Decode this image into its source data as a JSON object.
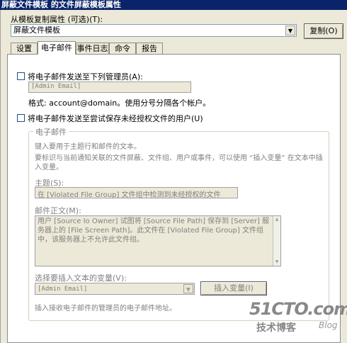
{
  "window": {
    "title": "屏蔽文件模板 的文件屏蔽模板属性"
  },
  "template_copy": {
    "label": "从模板复制属性 (可选)(T):",
    "selected": "屏蔽文件模板",
    "copy_button": "复制(O)"
  },
  "tabs": [
    {
      "label": "设置"
    },
    {
      "label": "电子邮件"
    },
    {
      "label": "事件日志"
    },
    {
      "label": "命令"
    },
    {
      "label": "报告"
    }
  ],
  "active_tab": "电子邮件",
  "email": {
    "admin_checkbox_label": "将电子邮件发送至下列管理员(A):",
    "admin_field_value": "[Admin Email]",
    "format_hint": "格式: account@domain。使用分号分隔各个帐户。",
    "user_checkbox_label": "将电子邮件发送至尝试保存未经授权文件的用户(U)",
    "group_title": "电子邮件",
    "group_desc_1": "键入要用于主题行和邮件的文本。",
    "group_desc_2": "要标识与当前通知关联的文件屏蔽、文件组、用户或事件，可以使用 “插入变量” 在文本中插入变量。",
    "subject_label": "主题(S):",
    "subject_value": "在 [Violated File Group] 文件组中检测到未经授权的文件",
    "body_label": "邮件正文(M):",
    "body_value": "用户 [Source Io Owner] 试图将 [Source File Path] 保存到 [Server] 服务器上的 [File Screen Path]。此文件在 [Violated File Group] 文件组中，该服务器上不允许此文件组。",
    "variable_label": "选择要插入文本的变量(V):",
    "variable_value": "[Admin Email]",
    "insert_button": "插入变量(I)",
    "variable_desc": "插入接收电子邮件的管理员的电子邮件地址。"
  },
  "watermark": {
    "logo": "51CTO.com",
    "sub": "技术博客",
    "blog": "Blog"
  },
  "icons": {
    "dropdown": "chevron-down-icon",
    "scroll_up": "arrow-up-icon",
    "scroll_down": "arrow-down-icon"
  }
}
